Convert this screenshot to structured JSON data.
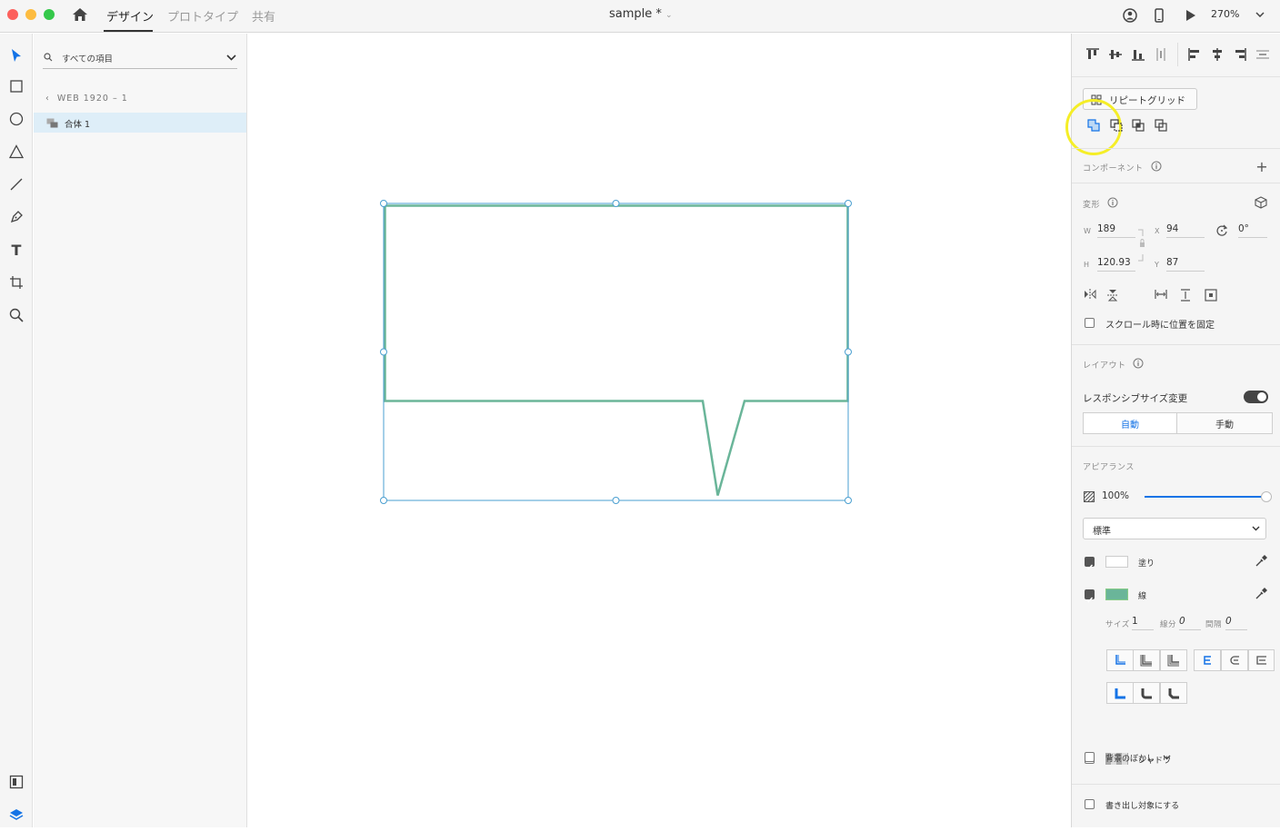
{
  "titlebar": {
    "tabs": [
      "デザイン",
      "プロトタイプ",
      "共有"
    ],
    "doc_title": "sample *",
    "zoom": "270%"
  },
  "layers": {
    "search_placeholder": "すべての項目",
    "breadcrumb": "WEB 1920 – 1",
    "items": [
      {
        "label": "合体 1"
      }
    ]
  },
  "properties": {
    "repeat_grid_label": "リピートグリッド",
    "component_label": "コンポーネント",
    "transform_label": "変形",
    "w_label": "W",
    "w_value": "189",
    "h_label": "H",
    "h_value": "120.93",
    "x_label": "X",
    "x_value": "94",
    "y_label": "Y",
    "y_value": "87",
    "rotation_value": "0°",
    "fix_on_scroll_label": "スクロール時に位置を固定",
    "layout_label": "レイアウト",
    "responsive_label": "レスポンシブサイズ変更",
    "auto_label": "自動",
    "manual_label": "手動",
    "appearance_label": "アピアランス",
    "opacity_value": "100%",
    "opacity_fraction": 1.0,
    "blend_mode": "標準",
    "fill_label": "塗り",
    "fill_color": "#ffffff",
    "stroke_label": "線",
    "stroke_color": "#6ab599",
    "size_label": "サイズ",
    "size_value": "1",
    "dash_label": "線分",
    "dash_value": "0",
    "gap_label": "間隔",
    "gap_value": "0",
    "shadow_label": "シャドウ",
    "bg_blur_label": "背景のぼかし",
    "export_label": "書き出し対象にする"
  },
  "colors": {
    "accent": "#1473e6",
    "selection": "#4a9fd0",
    "highlight": "#f5ee27"
  }
}
